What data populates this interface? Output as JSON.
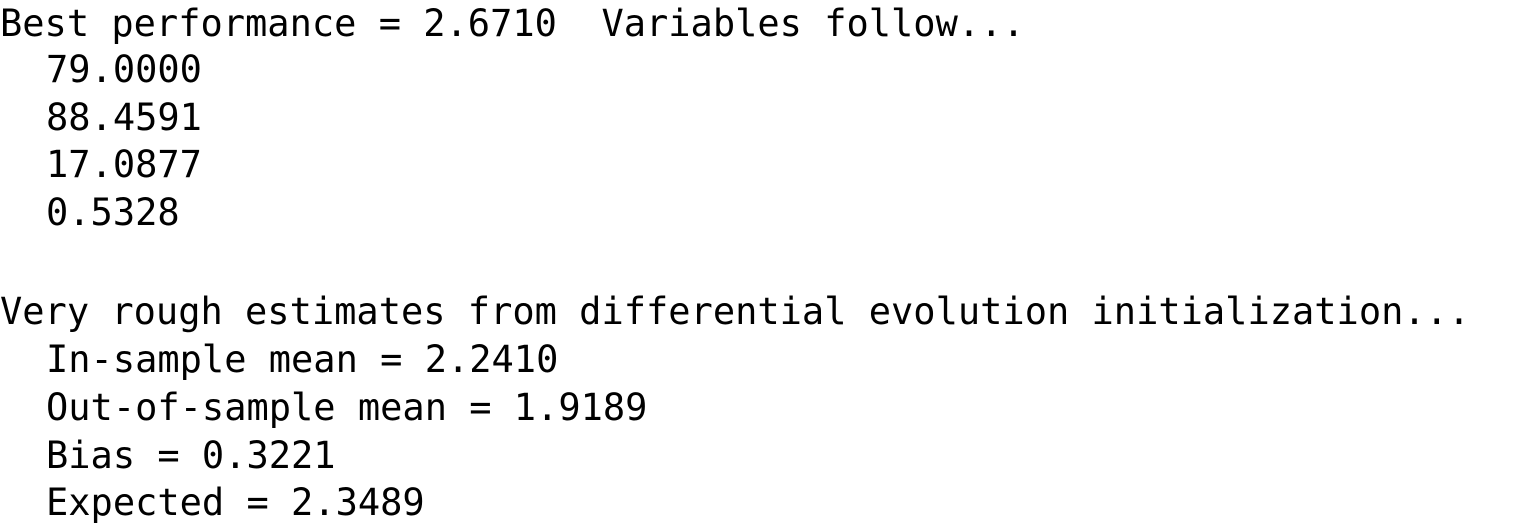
{
  "section1": {
    "heading": "Best performance = 2.6710  Variables follow...",
    "variables": [
      "79.0000",
      "88.4591",
      "17.0877",
      "0.5328"
    ]
  },
  "section2": {
    "heading": "Very rough estimates from differential evolution initialization...",
    "lines": [
      "In-sample mean = 2.2410",
      "Out-of-sample mean = 1.9189",
      "Bias = 0.3221",
      "Expected = 2.3489"
    ]
  }
}
